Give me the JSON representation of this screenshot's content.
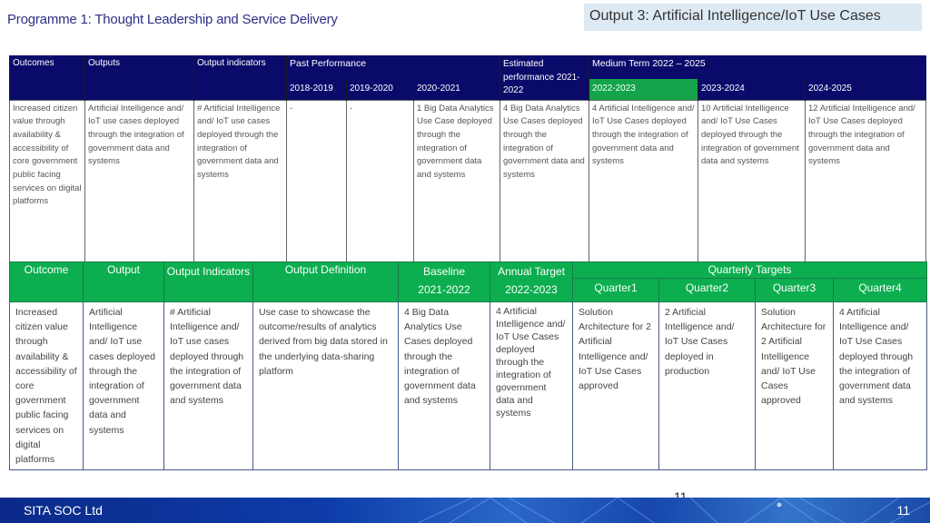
{
  "header": {
    "programme_title": "Programme 1: Thought Leadership and Service Delivery",
    "output_title": "Output 3: Artificial Intelligence/IoT Use Cases"
  },
  "table1": {
    "headers": {
      "outcomes": "Outcomes",
      "outputs": "Outputs",
      "output_indicators": "Output indicators",
      "past_performance": "Past Performance",
      "y2018": "2018-2019",
      "y2019": "2019-2020",
      "y2020": "2020-2021",
      "estimated": "Estimated performance 2021-2022",
      "medium_term": "Medium Term 2022 – 2025",
      "y2022": "2022-2023",
      "y2023": "2023-2024",
      "y2024": "2024-2025"
    },
    "row": {
      "outcomes": "Increased citizen value through availability & accessibility of core government public facing services on digital platforms",
      "outputs": "Artificial Intelligence and/ IoT use cases deployed through the integration of government data and systems",
      "output_indicators": "# Artificial Intelligence and/ IoT use cases deployed through the integration of government data and systems",
      "y2018": "-",
      "y2019": "-",
      "y2020": "1 Big Data Analytics Use Case deployed through the integration of government data and systems",
      "estimated": "4 Big Data Analytics Use Cases deployed through the integration of government data and systems",
      "y2022": "4 Artificial Intelligence and/ IoT Use Cases deployed through the integration of government data and systems",
      "y2023": "10 Artificial Intelligence and/ IoT Use Cases deployed through the integration of government data and systems",
      "y2024": "12 Artificial Intelligence and/ IoT Use Cases deployed through the integration of government data and systems"
    }
  },
  "table2": {
    "headers": {
      "outcome": "Outcome",
      "output": "Output",
      "output_indicators": "Output Indicators",
      "output_definition": "Output Definition",
      "baseline": "Baseline",
      "baseline_year": "2021-2022",
      "annual_target": "Annual Target",
      "annual_year": "2022-2023",
      "quarterly_targets": "Quarterly Targets",
      "q1": "Quarter1",
      "q2": "Quarter2",
      "q3": "Quarter3",
      "q4": "Quarter4"
    },
    "row": {
      "outcome": "Increased citizen value through availability & accessibility of core government public facing services on digital platforms",
      "output": "Artificial Intelligence and/ IoT use cases deployed through the integration of government data and systems",
      "output_indicators": "# Artificial Intelligence and/ IoT use cases deployed through the integration of government data and systems",
      "output_definition": "Use case to showcase the outcome/results of analytics derived from big data stored in the underlying data-sharing platform",
      "baseline": "4 Big Data Analytics Use Cases deployed through the integration of government data and systems",
      "annual_target": "4 Artificial Intelligence and/ IoT Use Cases deployed through the integration of government data and systems",
      "q1": "Solution Architecture for 2 Artificial Intelligence and/ IoT Use Cases approved",
      "q2": "2 Artificial Intelligence and/ IoT Use Cases deployed in production",
      "q3": "Solution Architecture for 2 Artificial Intelligence and/ IoT Use Cases approved",
      "q4": "4 Artificial Intelligence and/ IoT Use Cases deployed through the integration of government data and systems"
    }
  },
  "footer": {
    "organization": "SITA SOC Ltd",
    "page_number": "11",
    "page_number_overlay": "11"
  }
}
